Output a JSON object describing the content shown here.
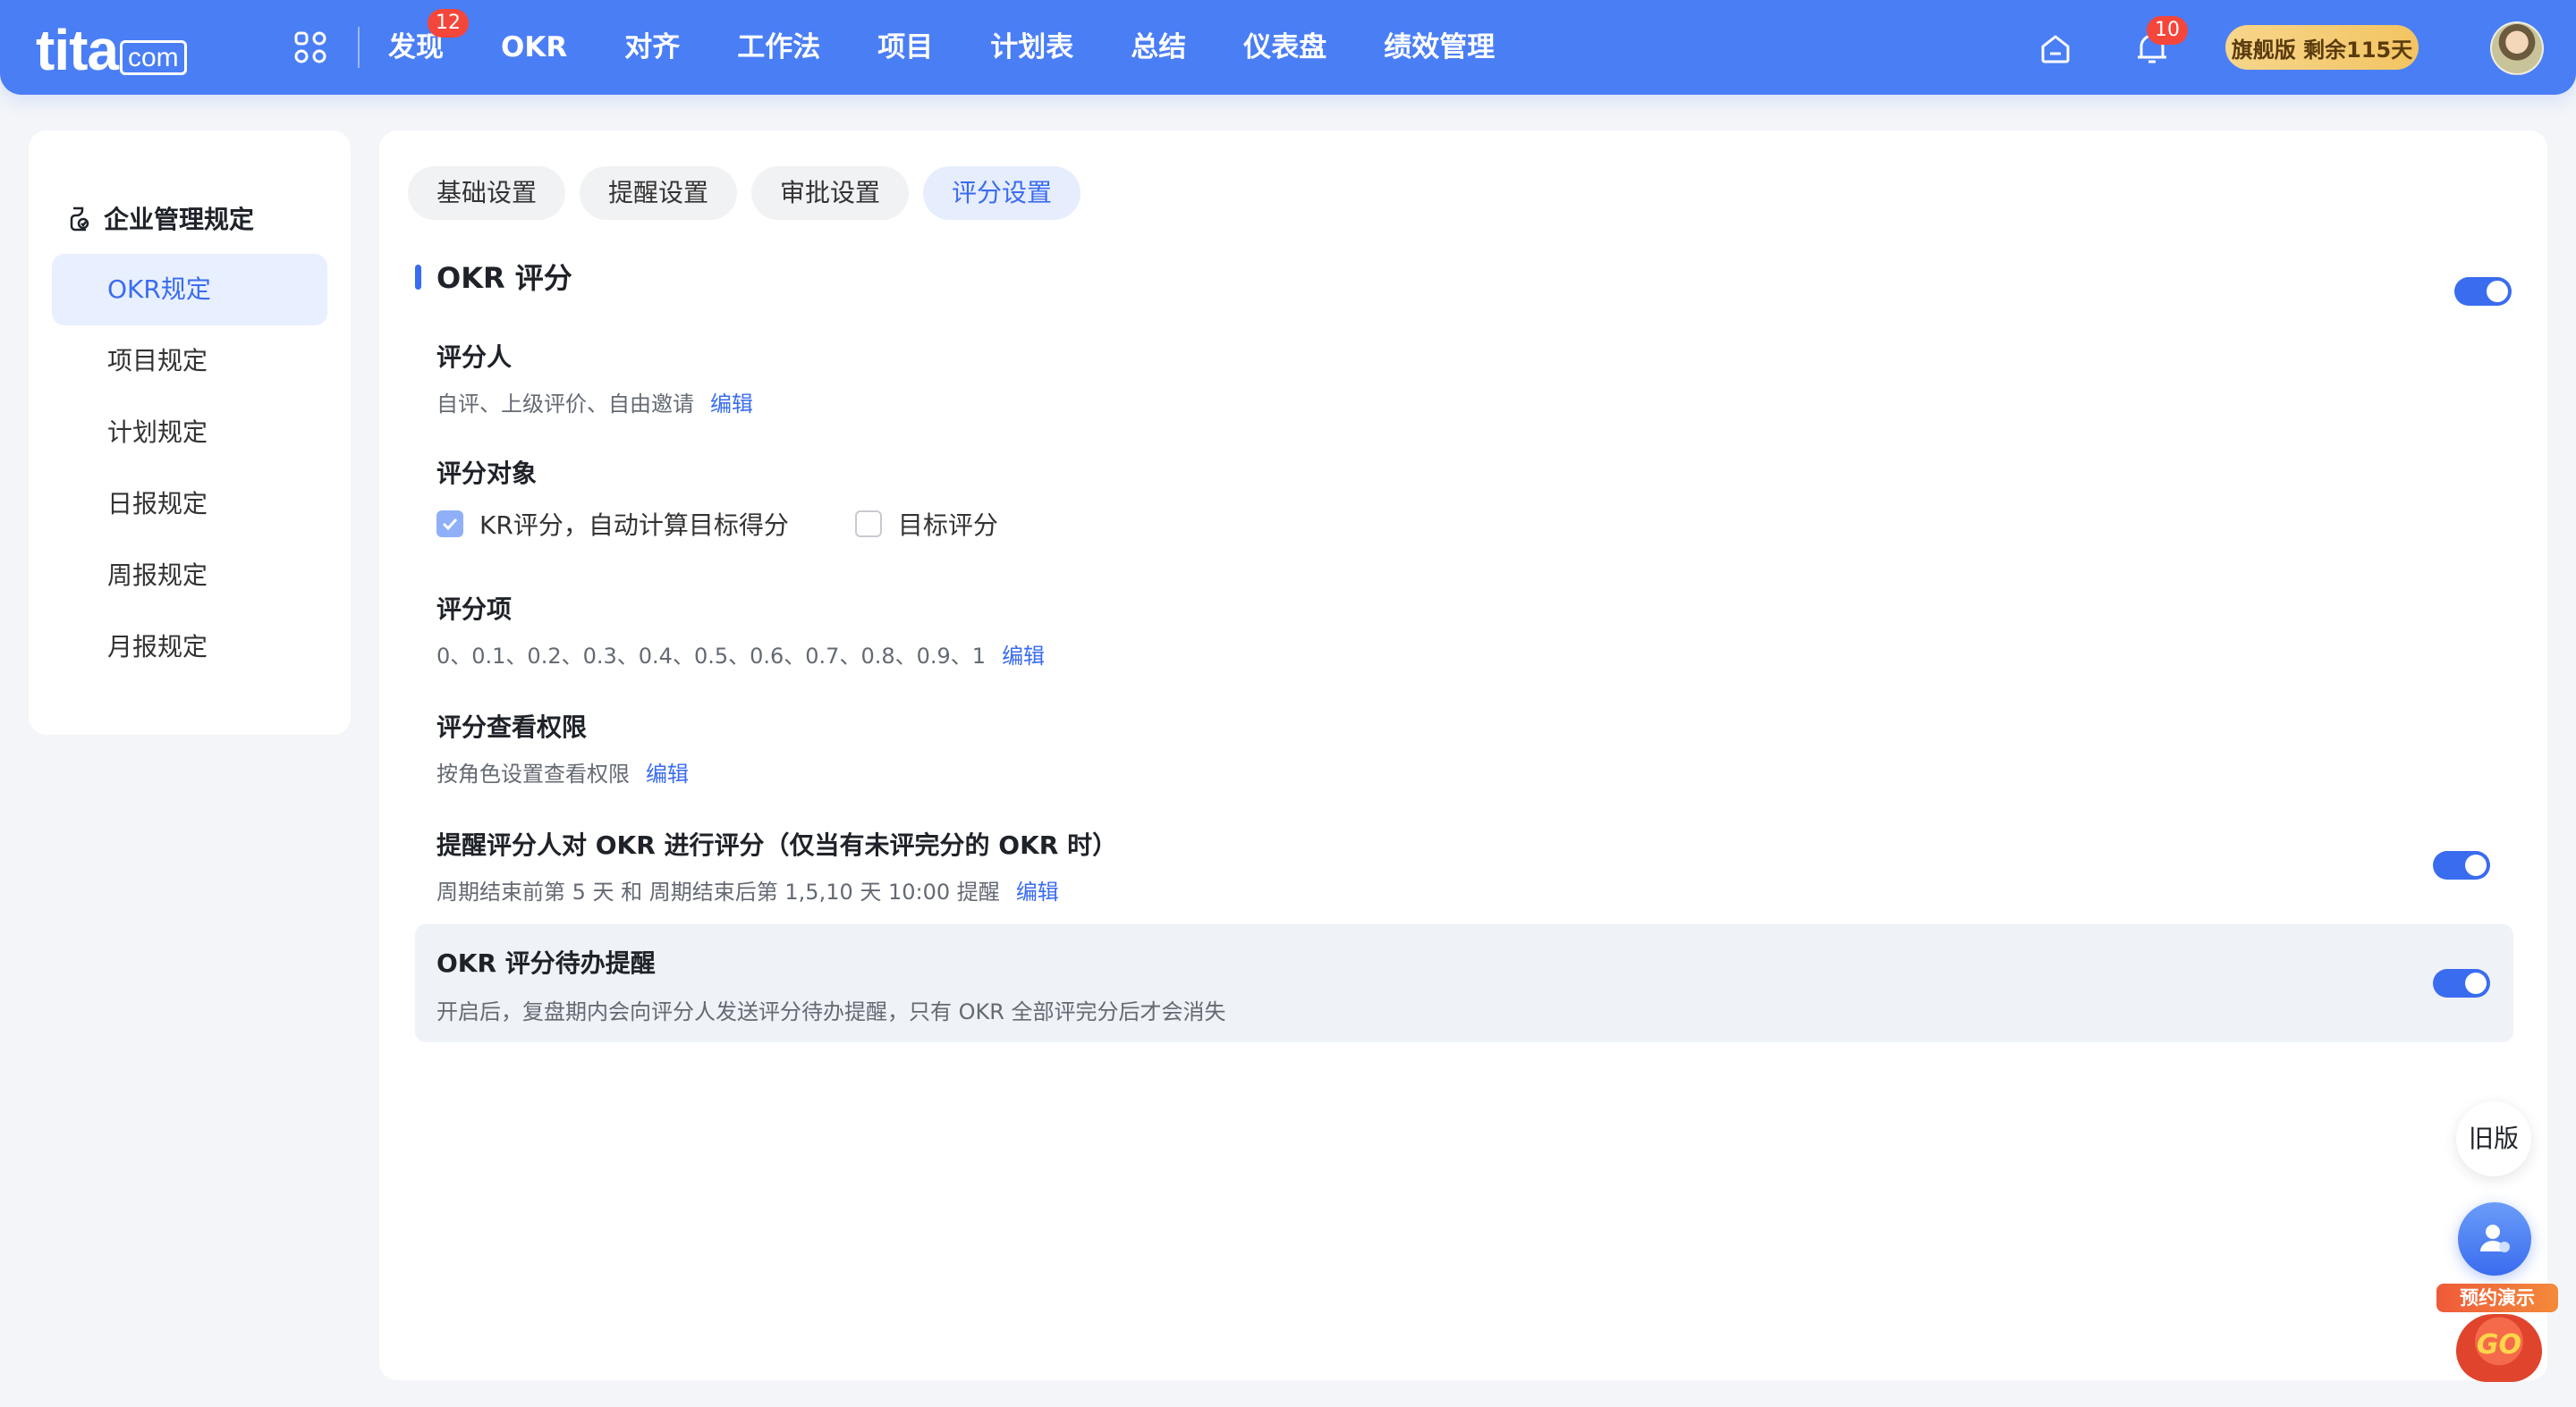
{
  "brand": {
    "logo_main": "tita",
    "logo_suffix": "com"
  },
  "nav": {
    "items": [
      {
        "label": "发现",
        "badge": "12"
      },
      {
        "label": "OKR"
      },
      {
        "label": "对齐"
      },
      {
        "label": "工作法"
      },
      {
        "label": "项目"
      },
      {
        "label": "计划表"
      },
      {
        "label": "总结"
      },
      {
        "label": "仪表盘"
      },
      {
        "label": "绩效管理"
      }
    ],
    "notifications_badge": "10",
    "plan_label": "旗舰版 剩余115天"
  },
  "sidebar": {
    "title": "企业管理规定",
    "items": [
      {
        "label": "OKR规定",
        "active": true
      },
      {
        "label": "项目规定"
      },
      {
        "label": "计划规定"
      },
      {
        "label": "日报规定"
      },
      {
        "label": "周报规定"
      },
      {
        "label": "月报规定"
      }
    ]
  },
  "tabs": [
    {
      "label": "基础设置"
    },
    {
      "label": "提醒设置"
    },
    {
      "label": "审批设置"
    },
    {
      "label": "评分设置",
      "active": true
    }
  ],
  "section": {
    "title": "OKR 评分",
    "enabled": true
  },
  "settings": {
    "scorer": {
      "label": "评分人",
      "value": "自评、上级评价、自由邀请",
      "edit": "编辑"
    },
    "target": {
      "label": "评分对象",
      "options": [
        {
          "label": "KR评分，自动计算目标得分",
          "checked": true
        },
        {
          "label": "目标评分",
          "checked": false
        }
      ]
    },
    "items": {
      "label": "评分项",
      "value": "0、0.1、0.2、0.3、0.4、0.5、0.6、0.7、0.8、0.9、1",
      "edit": "编辑"
    },
    "permission": {
      "label": "评分查看权限",
      "value": "按角色设置查看权限",
      "edit": "编辑"
    },
    "remind": {
      "label": "提醒评分人对 OKR 进行评分（仅当有未评完分的 OKR 时）",
      "value": "周期结束前第 5 天 和 周期结束后第 1,5,10 天 10:00 提醒",
      "edit": "编辑",
      "enabled": true
    },
    "todo": {
      "label": "OKR 评分待办提醒",
      "value": "开启后，复盘期内会向评分人发送评分待办提醒，只有 OKR 全部评完分后才会消失",
      "enabled": true
    }
  },
  "floaters": {
    "old_version": "旧版",
    "demo_label": "预约演示",
    "demo_go": "GO"
  },
  "colors": {
    "accent": "#3a6cf0",
    "topbar": "#4a7ef5",
    "badge": "#f5463b"
  }
}
